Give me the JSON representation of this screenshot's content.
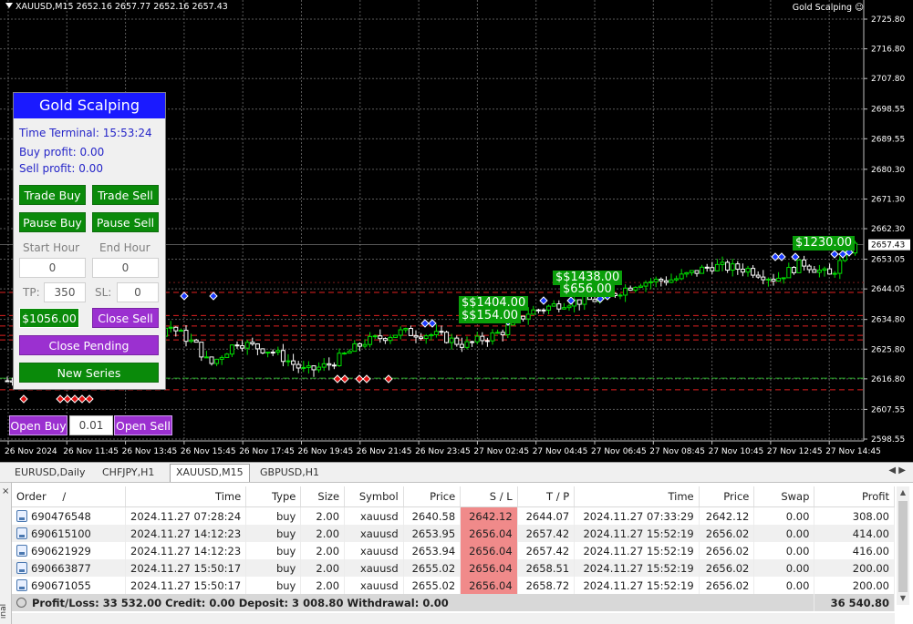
{
  "chart": {
    "info": "XAUUSD,M15  2652.16 2657.77 2652.16 2657.43",
    "ea_name": "Gold Scalping",
    "ea_face_icon": "smiley-icon",
    "price_levels": [
      "2725.80",
      "2716.80",
      "2707.80",
      "2698.55",
      "2689.55",
      "2680.30",
      "2671.30",
      "2662.30",
      "2653.05",
      "2644.05",
      "2634.80",
      "2625.80",
      "2616.80",
      "2607.55",
      "2598.55"
    ],
    "current_price": "2657.43",
    "time_labels": [
      "26 Nov 2024",
      "26 Nov 11:45",
      "26 Nov 13:45",
      "26 Nov 15:45",
      "26 Nov 17:45",
      "26 Nov 19:45",
      "26 Nov 21:45",
      "26 Nov 23:45",
      "27 Nov 02:45",
      "27 Nov 04:45",
      "27 Nov 06:45",
      "27 Nov 08:45",
      "27 Nov 10:45",
      "27 Nov 12:45",
      "27 Nov 14:45"
    ],
    "tags": [
      "$$1404.00",
      "$$154.00",
      "$$1438.00",
      "$656.00",
      "$1230.00"
    ],
    "colors": {
      "bull": "#00e000",
      "bear": "#ffffff",
      "grid": "#5a5a5a",
      "red_line": "#e02020",
      "green_line": "#20a020",
      "tag": "#0a9e0a"
    }
  },
  "panel": {
    "title": "Gold Scalping",
    "time_terminal": "Time Terminal: 15:53:24",
    "buy_profit": "Buy profit: 0.00",
    "sell_profit": "Sell profit: 0.00",
    "trade_buy": "Trade Buy",
    "trade_sell": "Trade Sell",
    "pause_buy": "Pause Buy",
    "pause_sell": "Pause Sell",
    "start_hour_label": "Start Hour",
    "end_hour_label": "End Hour",
    "start_hour": "0",
    "end_hour": "0",
    "tp_label": "TP:",
    "tp_value": "350",
    "sl_label": "SL:",
    "sl_value": "0",
    "profit_badge": "$1056.00",
    "close_sell": "Close Sell",
    "close_pending": "Close Pending",
    "new_series": "New Series",
    "open_buy": "Open Buy",
    "lot": "0.01",
    "open_sell": "Open Sell"
  },
  "tabs": [
    "EURUSD,Daily",
    "CHFJPY,H1",
    "XAUUSD,M15",
    "GBPUSD,H1"
  ],
  "active_tab": "XAUUSD,M15",
  "terminal": {
    "headers": [
      "Order",
      "/",
      "Time",
      "Type",
      "Size",
      "Symbol",
      "Price",
      "S / L",
      "T / P",
      "Time",
      "Price",
      "Swap",
      "Profit"
    ],
    "rows": [
      [
        "690476548",
        "2024.11.27 07:28:24",
        "buy",
        "2.00",
        "xauusd",
        "2640.58",
        "2642.12",
        "2644.07",
        "2024.11.27 07:33:29",
        "2642.12",
        "0.00",
        "308.00"
      ],
      [
        "690615100",
        "2024.11.27 14:12:23",
        "buy",
        "2.00",
        "xauusd",
        "2653.95",
        "2656.04",
        "2657.42",
        "2024.11.27 15:52:19",
        "2656.02",
        "0.00",
        "414.00"
      ],
      [
        "690621929",
        "2024.11.27 14:12:23",
        "buy",
        "2.00",
        "xauusd",
        "2653.94",
        "2656.04",
        "2657.42",
        "2024.11.27 15:52:19",
        "2656.02",
        "0.00",
        "416.00"
      ],
      [
        "690663877",
        "2024.11.27 15:50:17",
        "buy",
        "2.00",
        "xauusd",
        "2655.02",
        "2656.04",
        "2658.51",
        "2024.11.27 15:52:19",
        "2656.02",
        "0.00",
        "200.00"
      ],
      [
        "690671055",
        "2024.11.27 15:50:17",
        "buy",
        "2.00",
        "xauusd",
        "2655.02",
        "2656.04",
        "2658.72",
        "2024.11.27 15:52:19",
        "2656.02",
        "0.00",
        "200.00"
      ]
    ],
    "summary": "Profit/Loss: 33 532.00  Credit: 0.00  Deposit: 3 008.80  Withdrawal: 0.00",
    "summary_total": "36 540.80",
    "side_label": "inal"
  }
}
